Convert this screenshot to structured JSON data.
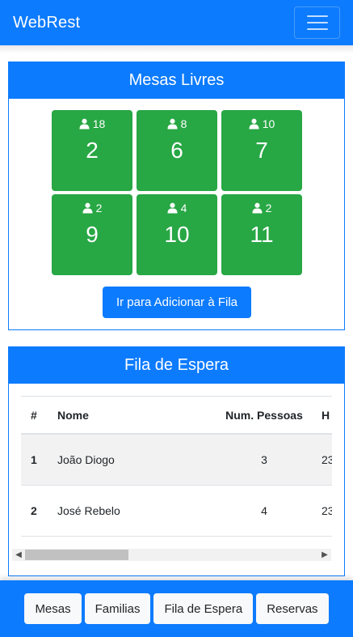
{
  "navbar": {
    "brand": "WebRest",
    "toggler_icon": "hamburger-icon"
  },
  "mesas": {
    "title": "Mesas Livres",
    "tables": [
      {
        "number": "2",
        "capacity": "18"
      },
      {
        "number": "6",
        "capacity": "8"
      },
      {
        "number": "7",
        "capacity": "10"
      },
      {
        "number": "9",
        "capacity": "2"
      },
      {
        "number": "10",
        "capacity": "4"
      },
      {
        "number": "11",
        "capacity": "2"
      }
    ],
    "button_label": "Ir para Adicionar à Fila"
  },
  "fila": {
    "title": "Fila de Espera",
    "columns": [
      "#",
      "Nome",
      "Num. Pessoas",
      "H"
    ],
    "rows": [
      {
        "idx": "1",
        "nome": "João Diogo",
        "num": "3",
        "hora": "23"
      },
      {
        "idx": "2",
        "nome": "José Rebelo",
        "num": "4",
        "hora": "23"
      }
    ]
  },
  "footer": {
    "buttons": [
      "Mesas",
      "Familias",
      "Fila de Espera",
      "Reservas"
    ]
  },
  "colors": {
    "primary": "#0d7bfd",
    "success": "#28a745"
  }
}
